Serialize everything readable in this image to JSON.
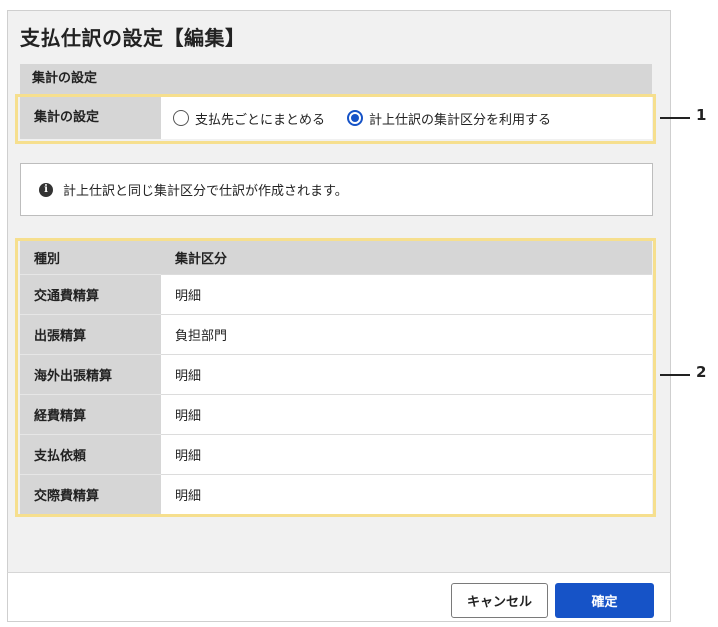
{
  "dialog": {
    "title": "支払仕訳の設定【編集】",
    "section_header": "集計の設定",
    "setting": {
      "label": "集計の設定",
      "options": [
        {
          "label": "支払先ごとにまとめる",
          "selected": false
        },
        {
          "label": "計上仕訳の集計区分を利用する",
          "selected": true
        }
      ]
    },
    "info": "計上仕訳と同じ集計区分で仕訳が作成されます。",
    "table": {
      "headers": [
        "種別",
        "集計区分"
      ],
      "rows": [
        [
          "交通費精算",
          "明細"
        ],
        [
          "出張精算",
          "負担部門"
        ],
        [
          "海外出張精算",
          "明細"
        ],
        [
          "経費精算",
          "明細"
        ],
        [
          "支払依頼",
          "明細"
        ],
        [
          "交際費精算",
          "明細"
        ]
      ]
    },
    "buttons": {
      "cancel": "キャンセル",
      "confirm": "確定"
    }
  },
  "callouts": [
    "1",
    "2"
  ],
  "colors": {
    "accent": "#1653c7",
    "highlight": "#f6df8e",
    "label_bg": "#d6d6d6"
  }
}
